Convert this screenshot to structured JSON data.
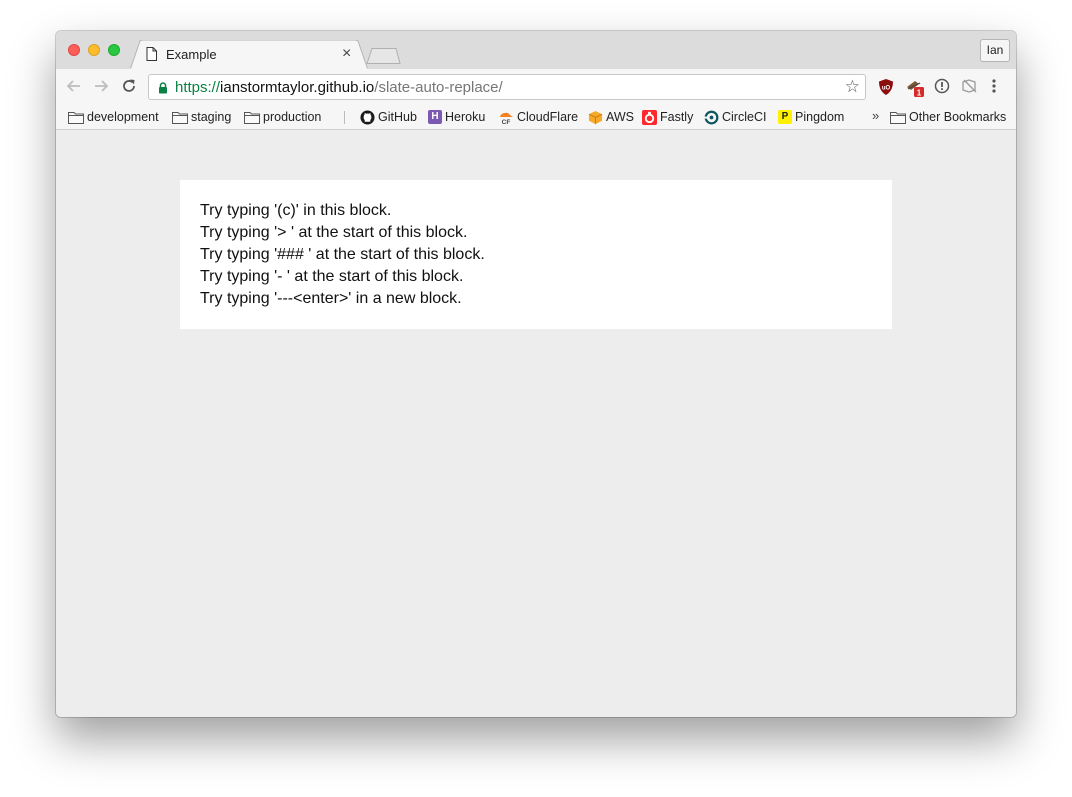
{
  "tab": {
    "title": "Example",
    "close_glyph": "×",
    "icon": "page-icon"
  },
  "profile": {
    "label": "Ian"
  },
  "address_bar": {
    "scheme": "https://",
    "host": "ianstormtaylor.github.io",
    "path": "/slate-auto-replace/",
    "bookmark_glyph": "☆"
  },
  "extensions": [
    {
      "name": "ublock-icon"
    },
    {
      "name": "extension-badge-icon",
      "badge": "1"
    },
    {
      "name": "info-circle-icon"
    },
    {
      "name": "reader-icon"
    },
    {
      "name": "menu-kebab-icon"
    }
  ],
  "bookmarks": {
    "items": [
      {
        "label": "development",
        "icon": "folder-icon"
      },
      {
        "label": "staging",
        "icon": "folder-icon"
      },
      {
        "label": "production",
        "icon": "folder-icon"
      },
      {
        "label": "GitHub",
        "icon": "github-icon"
      },
      {
        "label": "Heroku",
        "icon": "heroku-icon",
        "icon_text": "H",
        "color": "#7a5bb1"
      },
      {
        "label": "CloudFlare",
        "icon": "cloudflare-icon",
        "icon_text": "CF",
        "color": "#f48120"
      },
      {
        "label": "AWS",
        "icon": "aws-icon",
        "color": "#f7a928"
      },
      {
        "label": "Fastly",
        "icon": "fastly-icon",
        "color": "#ff282d"
      },
      {
        "label": "CircleCI",
        "icon": "circleci-icon",
        "color": "#11555f"
      },
      {
        "label": "Pingdom",
        "icon": "pingdom-icon",
        "icon_text": "P",
        "color": "#fff000"
      }
    ],
    "overflow_glyph": "»",
    "other_label": "Other Bookmarks"
  },
  "editor": {
    "lines": [
      "Try typing '(c)' in this block.",
      "Try typing '> ' at the start of this block.",
      "Try typing '### ' at the start of this block.",
      "Try typing '- ' at the start of this block.",
      "Try typing '---<enter>' in a new block."
    ]
  }
}
